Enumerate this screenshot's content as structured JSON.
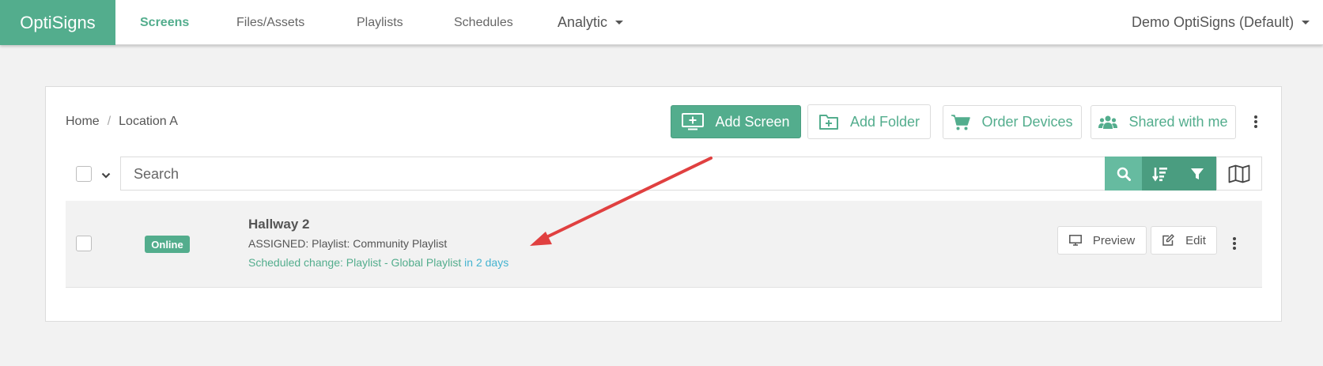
{
  "brand": "OptiSigns",
  "nav": {
    "screens": "Screens",
    "files": "Files/Assets",
    "playlists": "Playlists",
    "schedules": "Schedules",
    "analytic": "Analytic",
    "account": "Demo OptiSigns (Default)"
  },
  "breadcrumb": {
    "home": "Home",
    "separator": "/",
    "current": "Location A"
  },
  "toolbar": {
    "add_screen": "Add Screen",
    "add_folder": "Add Folder",
    "order_devices": "Order Devices",
    "shared_with_me": "Shared with me"
  },
  "search": {
    "placeholder": "Search"
  },
  "screens": [
    {
      "name": "Hallway 2",
      "status": "Online",
      "assigned": "ASSIGNED: Playlist: Community Playlist",
      "scheduled_change": "Scheduled change: Playlist - Global Playlist",
      "scheduled_when": "in 2 days",
      "preview_label": "Preview",
      "edit_label": "Edit"
    }
  ],
  "icons": {
    "add_screen": "monitor-plus-icon",
    "add_folder": "folder-plus-icon",
    "order_devices": "cart-icon",
    "shared_with_me": "users-icon",
    "search": "search-icon",
    "sort": "sort-icon",
    "filter": "filter-icon",
    "map": "map-icon",
    "preview": "monitor-icon",
    "edit": "edit-icon"
  },
  "colors": {
    "brand_green": "#53ad8d",
    "toolbar_light_green": "#66bba0",
    "toolbar_dark_green": "#4a9d80",
    "link_blue": "#45b4d0",
    "annotation_red": "#e04040",
    "background": "#f2f2f2"
  }
}
